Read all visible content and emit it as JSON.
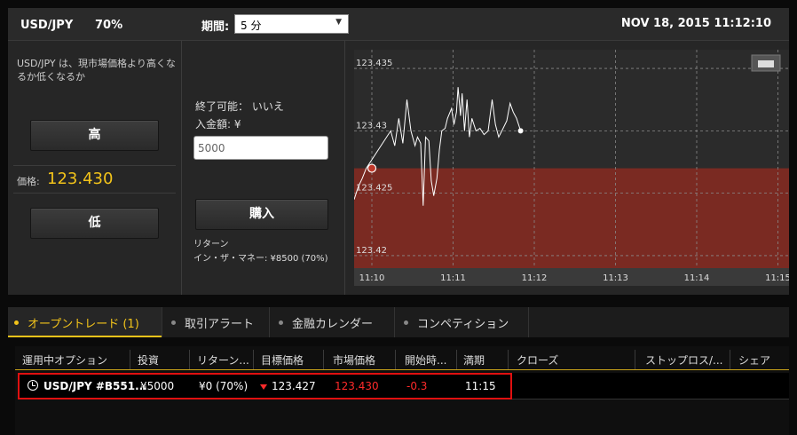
{
  "header": {
    "pair": "USD/JPY",
    "payout": "70%",
    "period_label": "期間:",
    "period_value": "5 分",
    "datetime": "NOV 18, 2015 11:12:10"
  },
  "left_panel": {
    "description": "USD/JPY は、現市場価格より高くなるか低くなるか",
    "high_label": "高",
    "price_label": "価格:",
    "price_value": "123.430",
    "low_label": "低"
  },
  "order_panel": {
    "end_available": "終了可能： いいえ",
    "amount_label": "入金額: ¥",
    "amount_value": "5000",
    "buy_label": "購入",
    "return_label": "リターン",
    "in_the_money": "イン・ザ・マネー: ¥8500 (70%)"
  },
  "chart_data": {
    "type": "line",
    "y_ticks": [
      "123.435",
      "123.43",
      "123.425",
      "123.42"
    ],
    "x_ticks": [
      "11:10",
      "11:11",
      "11:12",
      "11:13",
      "11:14",
      "11:15"
    ],
    "ylim": [
      123.419,
      123.4365
    ],
    "strike": 123.427,
    "colors": {
      "below_zone": "#7a2a22",
      "line": "#ffffff",
      "grid": "#8a8a8a"
    },
    "series": [
      {
        "values": [
          [
            0,
            123.4245
          ],
          [
            0.05,
            123.4255
          ],
          [
            0.1,
            123.4262
          ],
          [
            0.15,
            123.427
          ],
          [
            0.3,
            123.4285
          ],
          [
            0.45,
            123.43
          ],
          [
            0.5,
            123.4288
          ],
          [
            0.55,
            123.431
          ],
          [
            0.6,
            123.429
          ],
          [
            0.65,
            123.4325
          ],
          [
            0.7,
            123.43
          ],
          [
            0.75,
            123.4288
          ],
          [
            0.78,
            123.4295
          ],
          [
            0.82,
            123.429
          ],
          [
            0.85,
            123.424
          ],
          [
            0.88,
            123.4295
          ],
          [
            0.92,
            123.4292
          ],
          [
            0.95,
            123.426
          ],
          [
            0.98,
            123.4248
          ],
          [
            1.02,
            123.4262
          ],
          [
            1.05,
            123.4285
          ],
          [
            1.08,
            123.43
          ],
          [
            1.12,
            123.4302
          ],
          [
            1.15,
            123.431
          ],
          [
            1.2,
            123.4318
          ],
          [
            1.23,
            123.4305
          ],
          [
            1.26,
            123.4315
          ],
          [
            1.28,
            123.4335
          ],
          [
            1.31,
            123.4312
          ],
          [
            1.33,
            123.433
          ],
          [
            1.36,
            123.43
          ],
          [
            1.39,
            123.4325
          ],
          [
            1.42,
            123.4295
          ],
          [
            1.45,
            123.431
          ],
          [
            1.5,
            123.43
          ],
          [
            1.55,
            123.4302
          ],
          [
            1.6,
            123.4297
          ],
          [
            1.65,
            123.43
          ],
          [
            1.7,
            123.4325
          ],
          [
            1.74,
            123.4305
          ],
          [
            1.78,
            123.4295
          ],
          [
            1.82,
            123.43
          ],
          [
            1.88,
            123.4308
          ],
          [
            1.92,
            123.4322
          ],
          [
            1.96,
            123.4315
          ],
          [
            2.0,
            123.431
          ],
          [
            2.05,
            123.43
          ]
        ]
      }
    ]
  },
  "tabs": [
    {
      "label": "オープントレード (1)"
    },
    {
      "label": "取引アラート"
    },
    {
      "label": "金融カレンダー"
    },
    {
      "label": "コンペティション"
    }
  ],
  "table": {
    "columns": [
      "運用中オプション",
      "投資",
      "リターン...",
      "目標価格",
      "市場価格",
      "開始時...",
      "満期",
      "クローズ",
      "ストップロス/...",
      "シェア"
    ],
    "rows": [
      {
        "option": "USD/JPY #B551...",
        "investment": "¥5000",
        "return": "¥0 (70%)",
        "target": "123.427",
        "market": "123.430",
        "start": "-0.3",
        "expiry": "11:15"
      }
    ]
  }
}
